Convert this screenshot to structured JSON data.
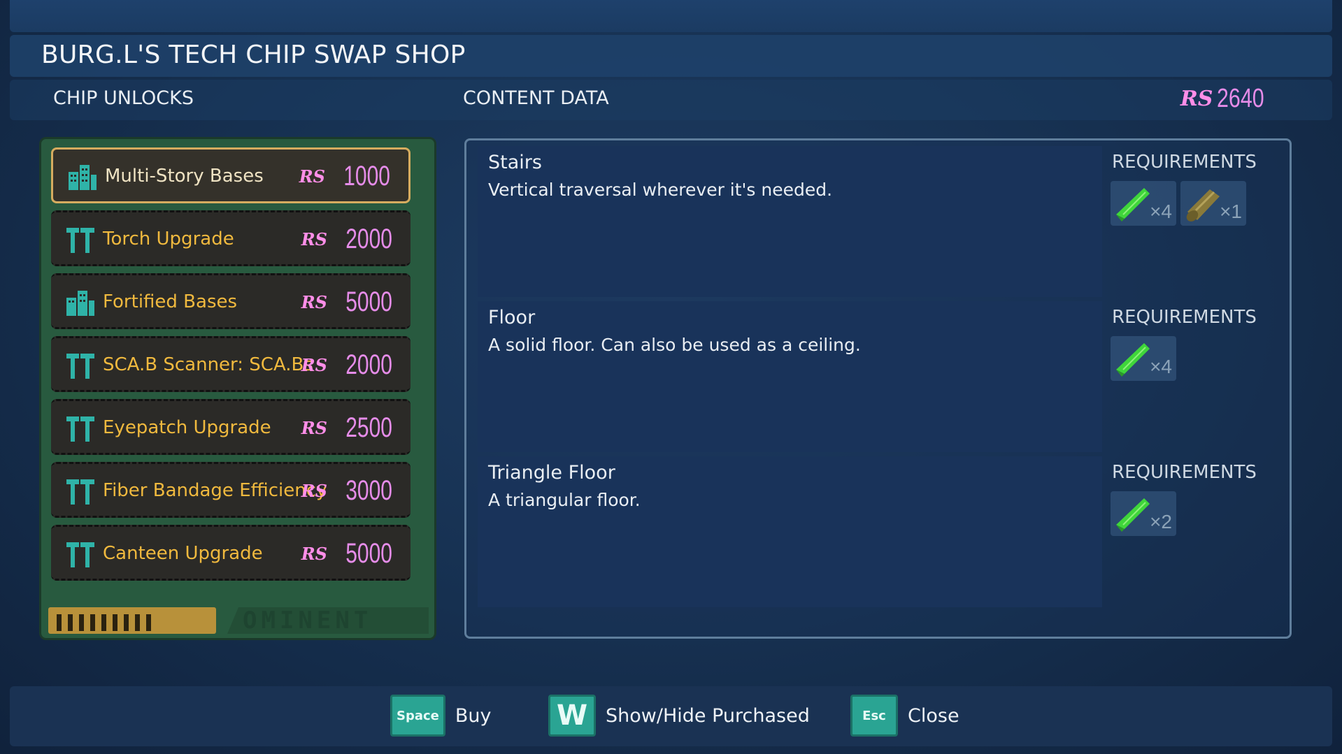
{
  "title": "BURG.L'S TECH CHIP SWAP SHOP",
  "sections": {
    "left": "CHIP UNLOCKS",
    "right": "CONTENT DATA"
  },
  "currency": {
    "symbol": "RS",
    "amount": "2640"
  },
  "chips": [
    {
      "label": "Multi-Story Bases",
      "price": "1000",
      "icon": "building-icon",
      "selected": true
    },
    {
      "label": "Torch Upgrade",
      "price": "2000",
      "icon": "tools-icon",
      "selected": false
    },
    {
      "label": "Fortified Bases",
      "price": "5000",
      "icon": "building-icon",
      "selected": false
    },
    {
      "label": "SCA.B Scanner: SCA.Bs",
      "price": "2000",
      "icon": "tools-icon",
      "selected": false
    },
    {
      "label": "Eyepatch Upgrade",
      "price": "2500",
      "icon": "tools-icon",
      "selected": false
    },
    {
      "label": "Fiber Bandage Efficiency",
      "price": "3000",
      "icon": "tools-icon",
      "selected": false
    },
    {
      "label": "Canteen Upgrade",
      "price": "5000",
      "icon": "tools-icon",
      "selected": false
    }
  ],
  "chip_brand": "OMINENT",
  "content": [
    {
      "name": "Stairs",
      "description": "Vertical traversal wherever it's needed.",
      "requirements_label": "REQUIREMENTS",
      "requirements": [
        {
          "icon": "grass-plank-icon",
          "qty": "×4"
        },
        {
          "icon": "weed-stem-icon",
          "qty": "×1"
        }
      ]
    },
    {
      "name": "Floor",
      "description": "A solid floor. Can also be used as a ceiling.",
      "requirements_label": "REQUIREMENTS",
      "requirements": [
        {
          "icon": "grass-plank-icon",
          "qty": "×4"
        }
      ]
    },
    {
      "name": "Triangle Floor",
      "description": "A triangular floor.",
      "requirements_label": "REQUIREMENTS",
      "requirements": [
        {
          "icon": "grass-plank-icon",
          "qty": "×2"
        }
      ]
    }
  ],
  "actions": [
    {
      "key": "Space",
      "label": "Buy"
    },
    {
      "key": "W",
      "label": "Show/Hide Purchased"
    },
    {
      "key": "Esc",
      "label": "Close"
    }
  ],
  "colors": {
    "accent_gold": "#f0b93e",
    "price_pink": "#e58ce8",
    "key_teal": "#2aa493",
    "chip_board_green": "#285a3f"
  }
}
